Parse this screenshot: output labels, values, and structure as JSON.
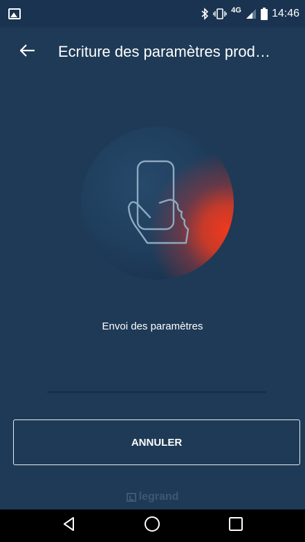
{
  "status_bar": {
    "network": "4G",
    "time": "14:46"
  },
  "app_bar": {
    "title": "Ecriture des paramètres prod…",
    "back_icon": "arrow-left-icon"
  },
  "hero": {
    "icon": "hand-holding-phone-icon",
    "accent_color": "#f0391c"
  },
  "status_message": "Envoi des paramètres",
  "progress": {
    "value": 0
  },
  "cancel_button": {
    "label": "ANNULER"
  },
  "brand": {
    "name": "legrand"
  },
  "nav": {
    "back_icon": "triangle-back-icon",
    "home_icon": "circle-home-icon",
    "recents_icon": "square-recents-icon"
  },
  "colors": {
    "background": "#1e3a56",
    "status_bar": "#1a3350",
    "nav_bar": "#000000"
  }
}
